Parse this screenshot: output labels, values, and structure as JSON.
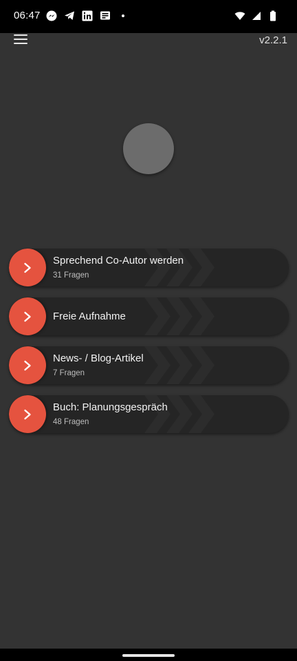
{
  "status_bar": {
    "time": "06:47",
    "notification_icons": [
      "messenger-icon",
      "telegram-icon",
      "linkedin-icon",
      "news-icon",
      "dot-icon"
    ],
    "system_icons": [
      "wifi-icon",
      "signal-icon",
      "battery-icon"
    ]
  },
  "app": {
    "version": "v2.2.1"
  },
  "colors": {
    "background": "#333333",
    "card": "#252525",
    "accent": "#e5533f",
    "avatar": "#6c6c6c"
  },
  "topics": [
    {
      "title": "Sprechend Co-Autor werden",
      "subtitle": "31 Fragen"
    },
    {
      "title": "Freie Aufnahme",
      "subtitle": ""
    },
    {
      "title": "News- / Blog-Artikel",
      "subtitle": "7 Fragen"
    },
    {
      "title": "Buch: Planungsgespräch",
      "subtitle": "48 Fragen"
    }
  ]
}
